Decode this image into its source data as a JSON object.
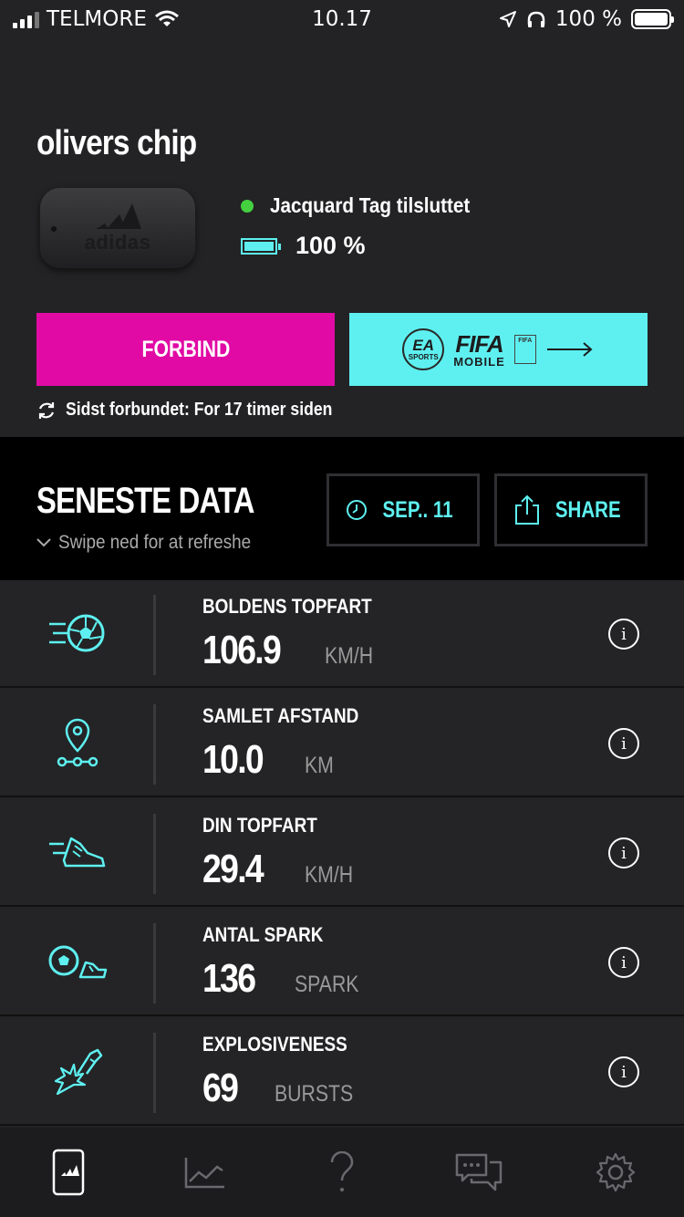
{
  "status": {
    "carrier": "TELMORE",
    "time": "10.17",
    "battery": "100 %"
  },
  "device": {
    "name": "olivers chip",
    "brand": "adidas",
    "connection_status": "Jacquard Tag tilsluttet",
    "battery_level": "100 %"
  },
  "actions": {
    "connect_label": "FORBIND",
    "fifa_ea": "EA",
    "fifa_sports": "SPORTS",
    "fifa_title": "FIFA",
    "fifa_mobile": "MOBILE",
    "fifa_badge": "FIFA",
    "last_connected": "Sidst forbundet: For 17 timer siden"
  },
  "data_section": {
    "title": "SENESTE DATA",
    "swipe_hint": "Swipe ned for at refreshe",
    "date_label": "SEP.. 11",
    "share_label": "SHARE"
  },
  "metrics": [
    {
      "label": "BOLDENS TOPFART",
      "value": "106.9",
      "unit": "KM/H",
      "icon": "ball-speed-icon"
    },
    {
      "label": "SAMLET AFSTAND",
      "value": "10.0",
      "unit": "KM",
      "icon": "distance-pin-icon"
    },
    {
      "label": "DIN TOPFART",
      "value": "29.4",
      "unit": "KM/H",
      "icon": "running-shoe-icon"
    },
    {
      "label": "ANTAL SPARK",
      "value": "136",
      "unit": "SPARK",
      "icon": "ball-kick-icon"
    },
    {
      "label": "EXPLOSIVENESS",
      "value": "69",
      "unit": "BURSTS",
      "icon": "explosive-shoe-icon"
    }
  ],
  "colors": {
    "accent_cyan": "#5ef0f0",
    "accent_magenta": "#e10aa5",
    "background": "#232325",
    "status_green": "#45d040"
  }
}
